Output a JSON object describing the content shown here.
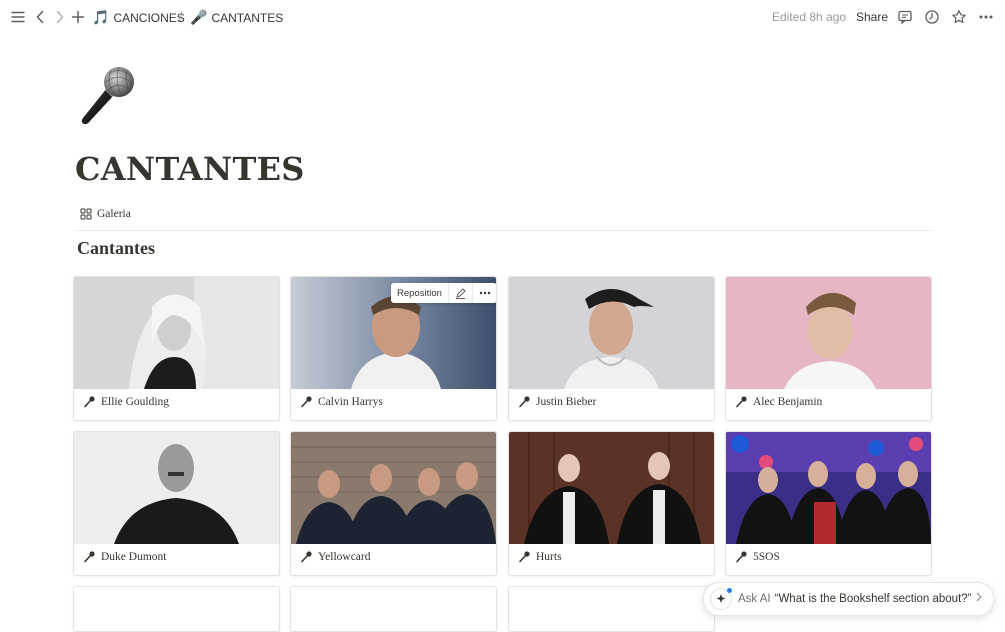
{
  "topbar": {
    "breadcrumbs": [
      {
        "emoji": "🎵",
        "label": "CANCIONES"
      },
      {
        "emoji": "🎤",
        "label": "CANTANTES"
      }
    ],
    "separator": "/",
    "edited": "Edited 8h ago",
    "share": "Share"
  },
  "page": {
    "icon": "microphone-icon",
    "title": "CANTANTES",
    "view_tab": "Galeria",
    "section": "Cantantes"
  },
  "hover_toolbar": {
    "reposition": "Reposition"
  },
  "cards": [
    {
      "name": "Ellie Goulding"
    },
    {
      "name": "Calvin Harrys"
    },
    {
      "name": "Justin Bieber"
    },
    {
      "name": "Alec Benjamin"
    },
    {
      "name": "Duke Dumont"
    },
    {
      "name": "Yellowcard"
    },
    {
      "name": "Hurts"
    },
    {
      "name": "5SOS"
    }
  ],
  "ask_ai": {
    "prefix": "Ask AI",
    "query": "“What is the Bookshelf section about?”"
  },
  "colors": {
    "text": "#37352f",
    "muted": "#9b9a97",
    "border": "#e3e2df"
  }
}
